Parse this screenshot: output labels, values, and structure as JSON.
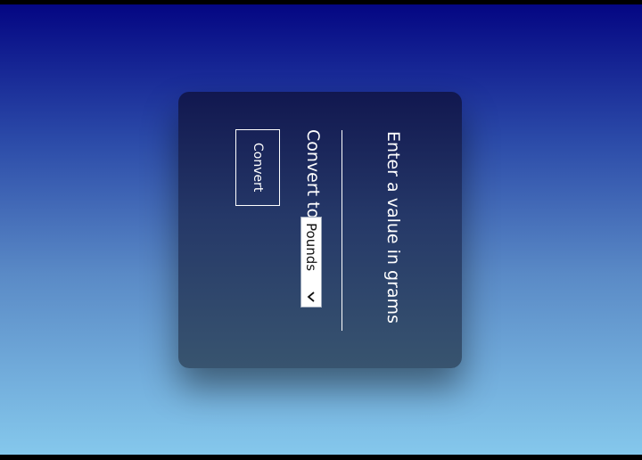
{
  "converter": {
    "prompt": "Enter a value in grams",
    "input_value": "",
    "convert_to_label": "Convert to:",
    "unit_select": {
      "selected": "Pounds",
      "icon": "chevron-down-icon"
    },
    "convert_button_label": "Convert"
  },
  "colors": {
    "bg_top": "#040683",
    "bg_bottom": "#85c8ec",
    "card_top": "#11174f",
    "card_bottom": "#38546f",
    "text": "#ffffff"
  }
}
